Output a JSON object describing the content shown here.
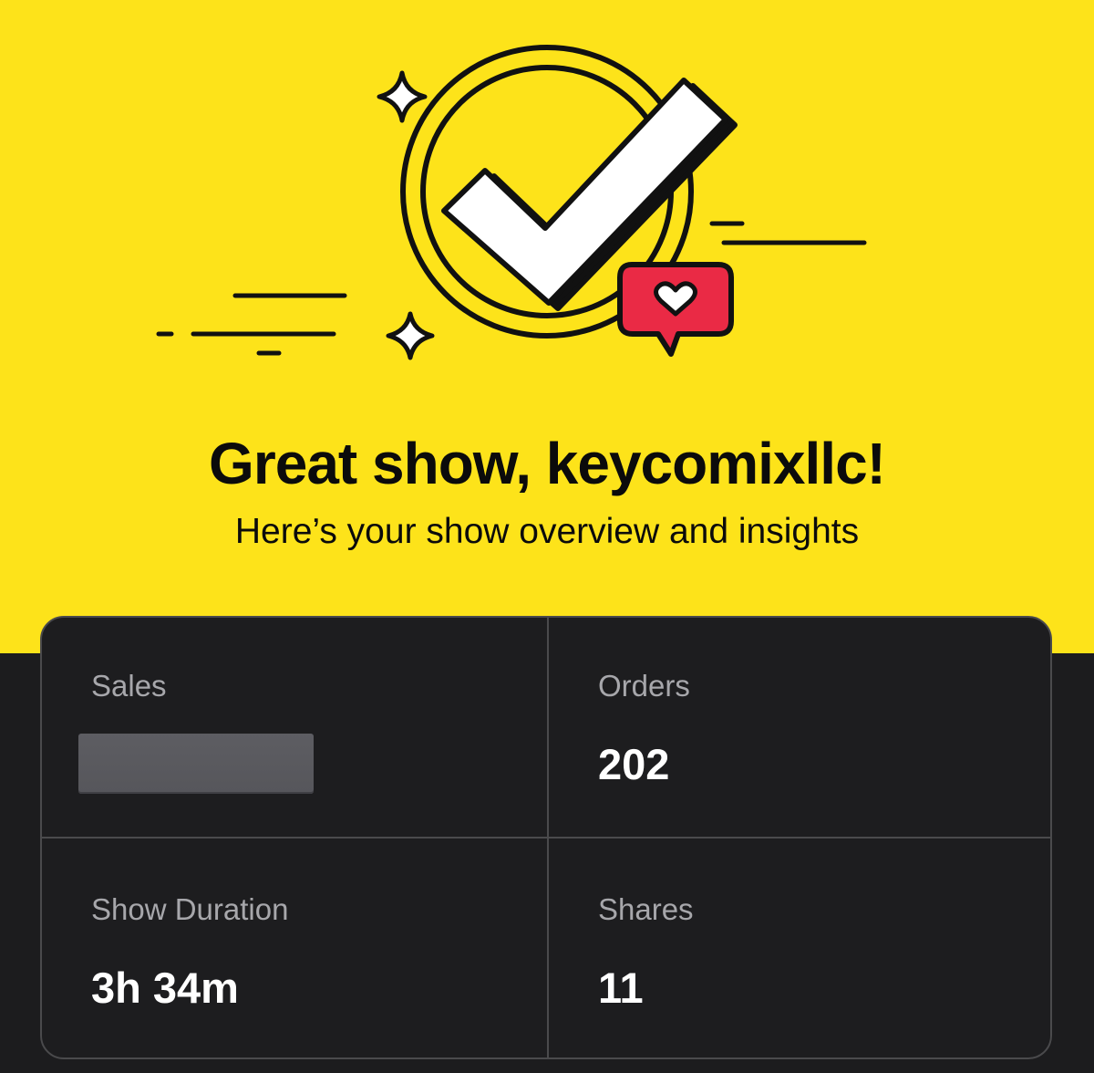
{
  "hero": {
    "title": "Great show, keycomixllc!",
    "subtitle": "Here’s your show overview and insights",
    "background_color": "#fde31a",
    "illustration_icons": [
      "check-circle-icon",
      "heart-chat-bubble-icon",
      "sparkle-icon",
      "speed-lines"
    ]
  },
  "stats": {
    "sales": {
      "label": "Sales",
      "value_redacted": true
    },
    "orders": {
      "label": "Orders",
      "value": "202"
    },
    "duration": {
      "label": "Show Duration",
      "value": "3h 34m"
    },
    "shares": {
      "label": "Shares",
      "value": "11"
    }
  },
  "colors": {
    "accent_yellow": "#fde31a",
    "card_background": "#1d1d1f",
    "heart_red": "#ea2a45",
    "label_gray": "#a7a7ab"
  }
}
